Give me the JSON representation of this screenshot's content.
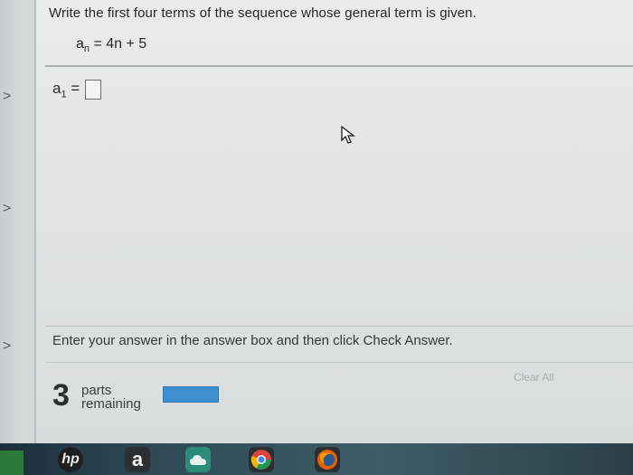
{
  "question": {
    "prompt": "Write the first four terms of the sequence whose general term is given.",
    "formula_a": "a",
    "formula_sub": "n",
    "formula_rest": " = 4n + 5"
  },
  "answer": {
    "label_a": "a",
    "label_sub": "1",
    "label_eq": " =",
    "value": ""
  },
  "instructions": "Enter your answer in the answer box and then click Check Answer.",
  "parts": {
    "count": "3",
    "line1": "parts",
    "line2": "remaining"
  },
  "buttons": {
    "clear_all": "Clear All"
  },
  "left_chevrons": [
    ">",
    ">",
    ">"
  ],
  "taskbar": {
    "hp": "hp",
    "amazon": "a"
  },
  "colors": {
    "progress": "#3d8fd0",
    "taskbar": "#2f4a55"
  }
}
